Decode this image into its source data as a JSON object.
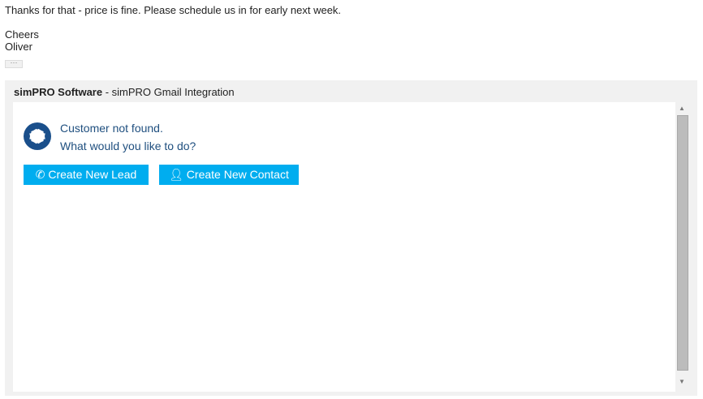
{
  "email": {
    "line1": "Thanks for that - price is fine. Please schedule us in for early next week.",
    "signoff": "Cheers",
    "name": "Oliver",
    "more": "···"
  },
  "addon": {
    "title_bold": "simPRO Software",
    "title_rest": " - simPRO Gmail Integration",
    "message1": "Customer not found.",
    "message2": "What would you like to do?",
    "lead_button": "Create New Lead",
    "contact_button": "Create New Contact",
    "accent": "#00adef"
  }
}
